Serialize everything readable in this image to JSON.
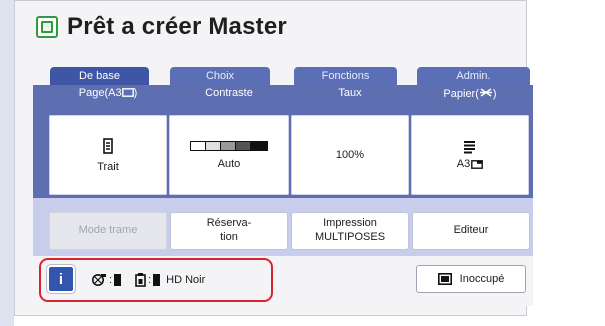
{
  "title": "Prêt a créer Master",
  "tabs": [
    "De base",
    "Choix",
    "Fonctions",
    "Admin."
  ],
  "columns": [
    "Page(A3",
    "Contraste",
    "Taux",
    "Papier("
  ],
  "cards": {
    "page": "Trait",
    "contrast": "Auto",
    "rate": "100%",
    "paper": "A3"
  },
  "actions": {
    "mode_trame": "Mode trame",
    "reservation_line1": "Réserva-",
    "reservation_line2": "tion",
    "impression_line1": "Impression",
    "impression_line2": "MULTIPOSES",
    "editeur": "Editeur"
  },
  "status": {
    "info": "i",
    "color": "HD Noir",
    "idle": "Inoccupé",
    "sep": ":"
  },
  "colors": {
    "tab_bar": "#5d6fb0",
    "action_bar": "#c7cdea",
    "info_button": "#3355b0",
    "highlight": "#d8242c",
    "title_icon": "#2f9a3f"
  }
}
